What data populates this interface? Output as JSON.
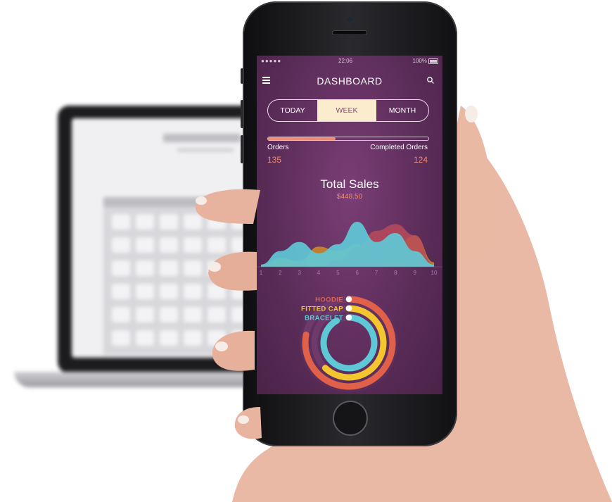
{
  "status_bar": {
    "signal": "●●●●●",
    "time": "22:06",
    "battery": "100%"
  },
  "header": {
    "title": "DASHBOARD",
    "menu_icon": "hamburger-menu-icon",
    "search_icon": "search-icon"
  },
  "tabs": [
    {
      "label": "TODAY",
      "active": false
    },
    {
      "label": "WEEK",
      "active": true
    },
    {
      "label": "MONTH",
      "active": false
    }
  ],
  "progress": {
    "fraction": 0.42,
    "color": "#f08a70"
  },
  "stats": {
    "orders_label": "Orders",
    "orders_value": "135",
    "completed_label": "Completed Orders",
    "completed_value": "124"
  },
  "total_sales": {
    "title": "Total Sales",
    "value": "$448.50"
  },
  "chart_data": [
    {
      "type": "area",
      "x": [
        1,
        2,
        3,
        4,
        5,
        6,
        7,
        8,
        9,
        10
      ],
      "x_tick_labels": [
        "1",
        "2",
        "3",
        "4",
        "5",
        "6",
        "7",
        "8",
        "9",
        "10"
      ],
      "series": [
        {
          "values": [
            1,
            8,
            5,
            18,
            14,
            20,
            10,
            18,
            28,
            4
          ],
          "color": "#c8852c"
        },
        {
          "values": [
            0,
            0,
            0,
            0,
            6,
            18,
            32,
            38,
            28,
            2
          ],
          "color": "#b84a5a"
        },
        {
          "values": [
            2,
            14,
            22,
            12,
            20,
            40,
            22,
            30,
            14,
            2
          ],
          "color": "#5fc8d6"
        }
      ],
      "ylim": [
        0,
        45
      ]
    },
    {
      "type": "radial-bar",
      "categories": [
        "HOODIE",
        "FITTED CAP",
        "BRACELET"
      ],
      "values": [
        0.78,
        0.62,
        0.92
      ],
      "colors": [
        "#e0604a",
        "#f3c630",
        "#5fc8d6"
      ]
    }
  ]
}
